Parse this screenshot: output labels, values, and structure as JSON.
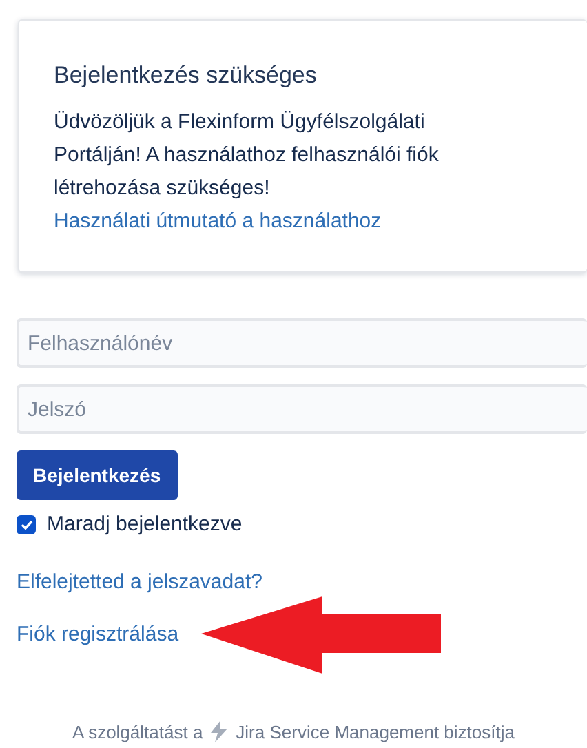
{
  "notice": {
    "title": "Bejelentkezés szükséges",
    "message": "Üdvözöljük a Flexinform Ügyfélszolgálati Portálján! A használathoz felhasználói fiók létrehozása szükséges!",
    "link": "Használati útmutató a használathoz"
  },
  "login": {
    "username": {
      "placeholder": "Felhasználónév"
    },
    "password": {
      "placeholder": "Jelszó"
    },
    "submit": "Bejelentkezés",
    "remember": {
      "label": "Maradj bejelentkezve",
      "checked": true
    }
  },
  "links": [
    {
      "label": "Elfelejtetted a jelszavadat?"
    },
    {
      "label": "Fiók regisztrálása"
    }
  ],
  "footer": {
    "prefix": "A szolgáltatást a",
    "product": "Jira Service Management biztosítja"
  }
}
